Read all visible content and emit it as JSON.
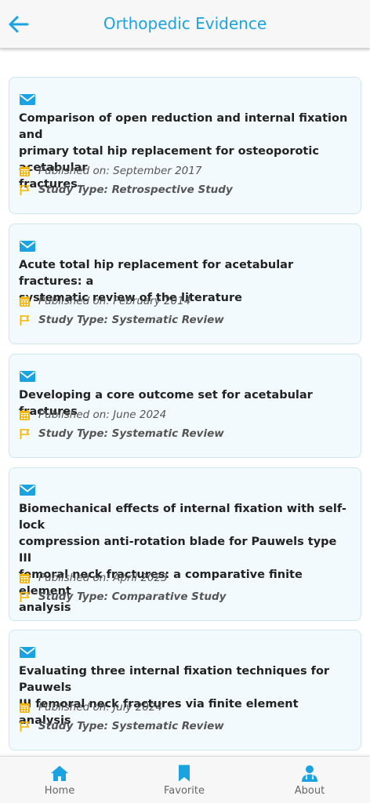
{
  "header": {
    "title": "Orthopedic Evidence"
  },
  "colors": {
    "accent": "#1aa3e0",
    "meta_icon": "#f5b400",
    "card_bg": "#f3fafd"
  },
  "articles": [
    {
      "icon": "mail-icon",
      "title_lines": [
        "Comparison of open reduction and internal fixation and",
        "primary total hip replacement for osteoporotic acetabular",
        "fractures"
      ],
      "published": "Published on: September 2017",
      "study_type": "Study Type: Retrospective Study"
    },
    {
      "icon": "mail-icon",
      "title_lines": [
        "Acute total hip replacement for acetabular fractures: a",
        "systematic review of the literature"
      ],
      "published": "Published on: February 2014",
      "study_type": "Study Type: Systematic Review"
    },
    {
      "icon": "mail-icon",
      "title_lines": [
        "Developing a core outcome set for acetabular fractures"
      ],
      "published": "Published on: June 2024",
      "study_type": "Study Type: Systematic Review"
    },
    {
      "icon": "mail-icon",
      "title_lines": [
        "Biomechanical effects of internal fixation with self-lock",
        "compression anti-rotation blade for Pauwels type III",
        "femoral neck fractures: a comparative finite element",
        "analysis"
      ],
      "published": "Published on: April 2023",
      "study_type": "Study Type: Comparative Study"
    },
    {
      "icon": "mail-icon",
      "title_lines": [
        "Evaluating three internal fixation techniques for Pauwels",
        "III femoral neck fractures via finite element analysis"
      ],
      "published": "Published on: July 2024",
      "study_type": "Study Type: Systematic Review"
    }
  ],
  "bottom_nav": [
    {
      "label": "Home",
      "icon": "home-icon",
      "active": true
    },
    {
      "label": "Favorite",
      "icon": "bookmark-icon",
      "active": false
    },
    {
      "label": "About",
      "icon": "doctor-icon",
      "active": false
    }
  ]
}
